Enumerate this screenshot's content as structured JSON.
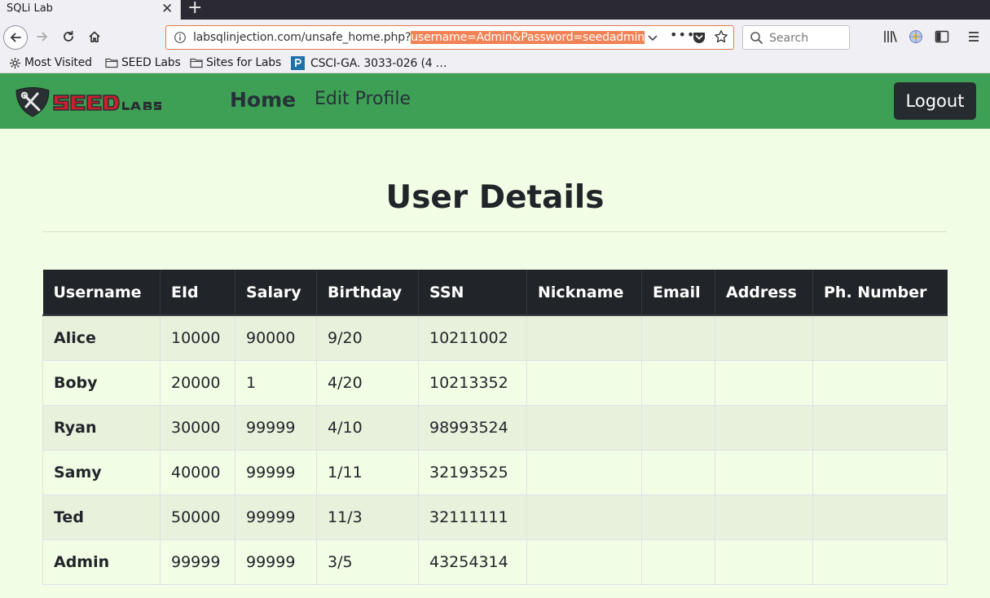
{
  "browser": {
    "tab_title": "SQLi Lab",
    "url_plain": "labsqlinjection.com/unsafe_home.php?",
    "url_highlighted": "username=Admin&Password=seedadmin",
    "search_placeholder": "Search",
    "bookmarks": [
      "Most Visited",
      "SEED Labs",
      "Sites for Labs",
      "CSCI-GA. 3033-026 (4 …"
    ]
  },
  "site": {
    "nav": {
      "home": "Home",
      "edit_profile": "Edit Profile",
      "logout": "Logout"
    },
    "page_title": "User Details",
    "table": {
      "headers": [
        "Username",
        "EId",
        "Salary",
        "Birthday",
        "SSN",
        "Nickname",
        "Email",
        "Address",
        "Ph. Number"
      ],
      "rows": [
        [
          "Alice",
          "10000",
          "90000",
          "9/20",
          "10211002",
          "",
          "",
          "",
          ""
        ],
        [
          "Boby",
          "20000",
          "1",
          "4/20",
          "10213352",
          "",
          "",
          "",
          ""
        ],
        [
          "Ryan",
          "30000",
          "99999",
          "4/10",
          "98993524",
          "",
          "",
          "",
          ""
        ],
        [
          "Samy",
          "40000",
          "99999",
          "1/11",
          "32193525",
          "",
          "",
          "",
          ""
        ],
        [
          "Ted",
          "50000",
          "99999",
          "11/3",
          "32111111",
          "",
          "",
          "",
          ""
        ],
        [
          "Admin",
          "99999",
          "99999",
          "3/5",
          "43254314",
          "",
          "",
          "",
          ""
        ]
      ]
    }
  },
  "colors": {
    "header_green": "#3ea055",
    "page_bg": "#f2fde6",
    "table_head": "#212529",
    "url_highlight": "#f08255"
  },
  "icons": [
    "back-icon",
    "forward-icon",
    "reload-icon",
    "home-icon",
    "info-icon",
    "chevron-down-icon",
    "more-icon",
    "pocket-icon",
    "star-icon",
    "search-icon",
    "library-icon",
    "extension-icon",
    "sidebar-icon",
    "menu-icon",
    "gear-icon",
    "folder-icon",
    "pearson-icon",
    "seed-labs-logo"
  ]
}
